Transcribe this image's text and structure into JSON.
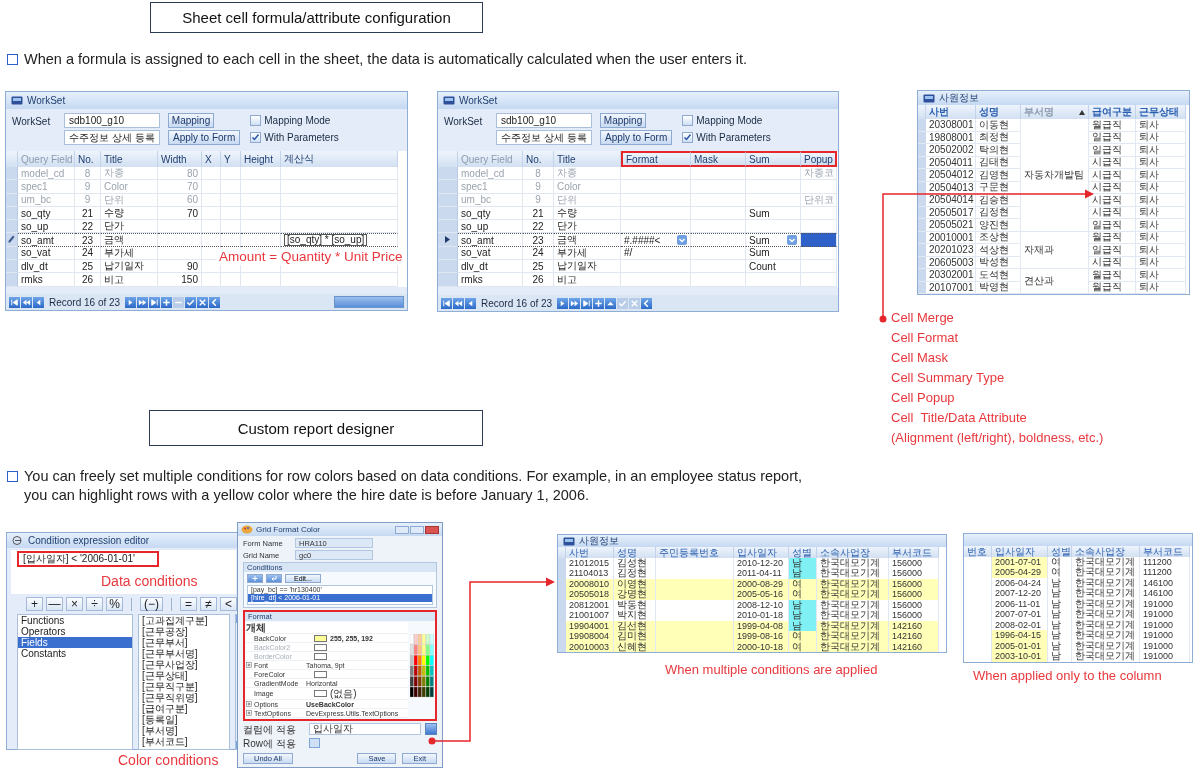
{
  "section1": {
    "heading": "Sheet cell formula/attribute configuration",
    "bullet": "When a formula is assigned to each cell in the sheet, the data is automatically calculated when the user enters it."
  },
  "workset_windows": [
    {
      "title": "WorkSet",
      "label": "WorkSet",
      "name_field": "sdb100_g10",
      "title_field": "수주정보 상세 등록",
      "buttons": [
        "Mapping",
        "Apply to Form"
      ],
      "checkboxes": [
        {
          "label": "Mapping Mode",
          "checked": false
        },
        {
          "label": "With Parameters",
          "checked": true
        }
      ],
      "kind": "edit",
      "scrollbar": true,
      "columns": [
        {
          "label": "Query Field",
          "highlighted": false
        },
        {
          "label": "No.",
          "highlighted": false
        },
        {
          "label": "Title",
          "highlighted": false
        },
        {
          "label": "Width",
          "highlighted": false
        },
        {
          "label": "X",
          "highlighted": false
        },
        {
          "label": "Y",
          "highlighted": false
        },
        {
          "label": "Height",
          "highlighted": false
        },
        {
          "label": "계산식",
          "highlighted": false
        }
      ],
      "rows": [
        {
          "cells": [
            "model_cd",
            "8",
            "차종",
            "80",
            null,
            null,
            null,
            null
          ],
          "disabled": true,
          "current": false
        },
        {
          "cells": [
            "spec1",
            "9",
            "Color",
            "70",
            null,
            null,
            null,
            null
          ],
          "disabled": true,
          "current": false
        },
        {
          "cells": [
            "um_bc",
            "9",
            "단위",
            "60",
            null,
            null,
            null,
            null
          ],
          "disabled": true,
          "current": false
        },
        {
          "cells": [
            "so_qty",
            "21",
            "수량",
            "70",
            null,
            null,
            null,
            null
          ],
          "disabled": false,
          "current": false
        },
        {
          "cells": [
            "so_up",
            "22",
            "단가",
            null,
            null,
            null,
            null,
            null
          ],
          "disabled": false,
          "current": false
        },
        {
          "cells": [
            "so_amt",
            "23",
            "금액",
            null,
            null,
            null,
            null,
            {
              "text": "[so_qty] * [so_up]",
              "editing": true
            }
          ],
          "disabled": false,
          "current": true
        },
        {
          "cells": [
            "so_vat",
            "24",
            "부가세",
            null,
            null,
            null,
            null,
            null
          ],
          "disabled": false,
          "current": false
        },
        {
          "cells": [
            "dlv_dt",
            "25",
            "납기일자",
            "90",
            null,
            null,
            null,
            null
          ],
          "disabled": false,
          "current": false
        },
        {
          "cells": [
            "rmks",
            "26",
            "비고",
            "150",
            null,
            null,
            null,
            null
          ],
          "disabled": false,
          "current": false
        }
      ],
      "annotation": "Amount = Quantity * Unit Price",
      "nav": [
        {
          "kind": "first",
          "disabled": false
        },
        {
          "kind": "prev-page",
          "disabled": false
        },
        {
          "kind": "prev",
          "disabled": false
        },
        {
          "kind": "record",
          "text": "Record 16 of 23"
        },
        {
          "kind": "next",
          "disabled": false
        },
        {
          "kind": "next-page",
          "disabled": false
        },
        {
          "kind": "last",
          "disabled": false
        },
        {
          "kind": "add",
          "disabled": false
        },
        {
          "kind": "remove",
          "disabled": true
        },
        {
          "kind": "ok",
          "disabled": false
        },
        {
          "kind": "cancel",
          "disabled": false
        },
        {
          "kind": "back",
          "disabled": false
        }
      ]
    },
    {
      "title": "WorkSet",
      "label": "WorkSet",
      "name_field": "sdb100_g10",
      "title_field": "수주정보 상세 등록",
      "buttons": [
        "Mapping",
        "Apply to Form"
      ],
      "checkboxes": [
        {
          "label": "Mapping Mode",
          "checked": false
        },
        {
          "label": "With Parameters",
          "checked": true
        }
      ],
      "kind": "browse",
      "columns": [
        {
          "label": "Query Field",
          "highlighted": false
        },
        {
          "label": "No.",
          "highlighted": false
        },
        {
          "label": "Title",
          "highlighted": false
        },
        {
          "label": "Format",
          "highlighted": true
        },
        {
          "label": "Mask",
          "highlighted": true
        },
        {
          "label": "Sum",
          "highlighted": true
        },
        {
          "label": "Popup",
          "highlighted": true
        }
      ],
      "rows": [
        {
          "cells": [
            "model_cd",
            "8",
            "차종",
            null,
            null,
            null,
            "차종코"
          ],
          "disabled": true,
          "current": false
        },
        {
          "cells": [
            "spec1",
            "9",
            "Color",
            null,
            null,
            null,
            null
          ],
          "disabled": true,
          "current": false
        },
        {
          "cells": [
            "um_bc",
            "9",
            "단위",
            null,
            null,
            null,
            "단위코"
          ],
          "disabled": true,
          "current": false
        },
        {
          "cells": [
            "so_qty",
            "21",
            "수량",
            null,
            null,
            "Sum",
            null
          ],
          "disabled": false,
          "current": false
        },
        {
          "cells": [
            "so_up",
            "22",
            "단가",
            null,
            null,
            null,
            null
          ],
          "disabled": false,
          "current": false
        },
        {
          "cells": [
            "so_amt",
            "23",
            "금액",
            {
              "text": "#.####<",
              "dropdown": true
            },
            null,
            {
              "text": "Sum",
              "dropdown": true
            },
            {
              "selected": true
            }
          ],
          "disabled": false,
          "current": true
        },
        {
          "cells": [
            "so_vat",
            "24",
            "부가세",
            "#/",
            null,
            "Sum",
            null
          ],
          "disabled": false,
          "current": false
        },
        {
          "cells": [
            "dlv_dt",
            "25",
            "납기일자",
            null,
            null,
            "Count",
            null
          ],
          "disabled": false,
          "current": false
        },
        {
          "cells": [
            "rmks",
            "26",
            "비고",
            null,
            null,
            null,
            null
          ],
          "disabled": false,
          "current": false
        }
      ],
      "nav": [
        {
          "kind": "first",
          "disabled": false
        },
        {
          "kind": "prev-page",
          "disabled": false
        },
        {
          "kind": "prev",
          "disabled": false
        },
        {
          "kind": "record",
          "text": "Record 16 of 23"
        },
        {
          "kind": "next",
          "disabled": false
        },
        {
          "kind": "next-page",
          "disabled": false
        },
        {
          "kind": "last",
          "disabled": false
        },
        {
          "kind": "add",
          "disabled": false
        },
        {
          "kind": "up",
          "disabled": false
        },
        {
          "kind": "ok",
          "disabled": true
        },
        {
          "kind": "cancel",
          "disabled": true
        },
        {
          "kind": "back",
          "disabled": false
        }
      ]
    }
  ],
  "employee_window": {
    "title": "사원정보",
    "columns": [
      {
        "label": "사번",
        "sorted": false
      },
      {
        "label": "성명",
        "sorted": false
      },
      {
        "label": "부서명",
        "sorted": true
      },
      {
        "label": "급여구분",
        "sorted": false
      },
      {
        "label": "근무상태",
        "sorted": false
      }
    ],
    "groups": [
      {
        "department": "자동차개발팀",
        "rows": [
          {
            "id": "20308001",
            "name": "이동현",
            "pay": "월급직",
            "status": "퇴사"
          },
          {
            "id": "19808001",
            "name": "최정현",
            "pay": "일급직",
            "status": "퇴사"
          },
          {
            "id": "20502002",
            "name": "탁의현",
            "pay": "일급직",
            "status": "퇴사"
          },
          {
            "id": "20504011",
            "name": "김태현",
            "pay": "시급직",
            "status": "퇴사"
          },
          {
            "id": "20504012",
            "name": "김영현",
            "pay": "시급직",
            "status": "퇴사"
          },
          {
            "id": "20504013",
            "name": "구문현",
            "pay": "시급직",
            "status": "퇴사"
          },
          {
            "id": "20504014",
            "name": "김승현",
            "pay": "시급직",
            "status": "퇴사"
          },
          {
            "id": "20505017",
            "name": "김정현",
            "pay": "시급직",
            "status": "퇴사"
          },
          {
            "id": "20505021",
            "name": "양진현",
            "pay": "일급직",
            "status": "퇴사"
          }
        ]
      },
      {
        "department": "자재과",
        "rows": [
          {
            "id": "20010001",
            "name": "조상현",
            "pay": "월급직",
            "status": "퇴사"
          },
          {
            "id": "20201023",
            "name": "석상현",
            "pay": "일급직",
            "status": "퇴사"
          },
          {
            "id": "20605003",
            "name": "박성현",
            "pay": "시급직",
            "status": "퇴사"
          }
        ]
      },
      {
        "department": "견산과",
        "rows": [
          {
            "id": "20302001",
            "name": "도석현",
            "pay": "월급직",
            "status": "퇴사"
          },
          {
            "id": "20107001",
            "name": "박영현",
            "pay": "월급직",
            "status": "퇴사"
          }
        ]
      }
    ]
  },
  "callouts": [
    "Cell Merge",
    "Cell Format",
    "Cell Mask",
    "Cell Summary Type",
    "Cell Popup",
    "Cell  Title/Data Attribute",
    "(Alignment (left/right), boldness, etc.)"
  ],
  "section2": {
    "heading": "Custom report designer",
    "bullet": "You can freely set multiple conditions for row colors based on data conditions. For example, in an employee status report, you can highlight rows with a yellow color where the hire date is before January 1, 2006."
  },
  "condition_editor": {
    "title": "Condition expression editor",
    "expression": "[입사일자] < '2006-01-01'",
    "annotation": "Data conditions",
    "operator_groups": [
      [
        "+",
        "—",
        "×",
        "÷",
        "%"
      ],
      [
        "(−)"
      ],
      [
        "=",
        "≠",
        "<"
      ]
    ],
    "categories": [
      {
        "label": "Functions",
        "selected": false
      },
      {
        "label": "Operators",
        "selected": false
      },
      {
        "label": "Fields",
        "selected": true
      },
      {
        "label": "Constants",
        "selected": false
      }
    ],
    "fields": [
      "[고과집계구분]",
      "[근무공장]",
      "[근무부서]",
      "[근무부서명]",
      "[근무사업장]",
      "[근무상태]",
      "[근무직구분]",
      "[근무직위명]",
      "[급여구분]",
      "[등록일]",
      "[부서명]",
      "[부서코드]"
    ]
  },
  "color_annotation": "Color conditions",
  "format_dialog": {
    "title": "Grid Format Color",
    "form_name_label": "Form Name",
    "form_name": "HRA110",
    "grid_name_label": "Grid Name",
    "grid_name": "gc0",
    "conditions_label": "Conditions",
    "edit_button": "Edit...",
    "conditions": [
      {
        "text": "[pay_bc] == 'hr130400'",
        "selected": false
      },
      {
        "text": "[hire_dt] < 2006-01-01",
        "selected": true
      }
    ],
    "format_label": "Format",
    "properties": [
      {
        "name": "개체",
        "kind": "category"
      },
      {
        "name": "BackColor",
        "kind": "color",
        "color": "#ffff99",
        "value": "255, 255, 192",
        "bold": true,
        "disabled": false
      },
      {
        "name": "BackColor2",
        "kind": "color",
        "color": "#ffffff",
        "disabled": true
      },
      {
        "name": "BorderColor",
        "kind": "color",
        "color": "#ffffff",
        "disabled": true
      },
      {
        "name": "Font",
        "kind": "group",
        "value": "Tahoma, 9pt",
        "bold": false
      },
      {
        "name": "ForeColor",
        "kind": "color",
        "color": "#ffffff",
        "disabled": false
      },
      {
        "name": "GradientMode",
        "kind": "text",
        "value": "Horizontal",
        "bold": false
      },
      {
        "name": "Image",
        "kind": "color",
        "color": "#ffffff",
        "value": "(없음)",
        "bold": false,
        "disabled": false
      },
      {
        "name": "Options",
        "kind": "group",
        "value": "UseBackColor",
        "bold": true
      },
      {
        "name": "TextOptions",
        "kind": "group",
        "value": "DevExpress.Utils.TextOptions",
        "bold": false
      }
    ],
    "apply_column": {
      "label": "컬럼에 적용",
      "value": "입사일자"
    },
    "apply_row": {
      "label": "Row에 적용",
      "checked": false
    },
    "buttons": [
      "Undo All",
      "Save",
      "Exit"
    ]
  },
  "report_grids": [
    {
      "title": "사원정보",
      "columns": [
        "사번",
        "성명",
        "주민등록번호",
        "입사일자",
        "성별",
        "소속사업장",
        "부서코드"
      ],
      "rows": [
        {
          "cells": [
            "21012015",
            "김성현",
            null,
            "2010-12-20",
            {
              "text": "남",
              "highlighted": true
            },
            "한국대모기계",
            "156000"
          ],
          "highlighted": false
        },
        {
          "cells": [
            "21104013",
            "김정현",
            null,
            "2011-04-11",
            {
              "text": "남",
              "highlighted": true
            },
            "한국대모기계",
            "156000"
          ],
          "highlighted": false
        },
        {
          "cells": [
            "20008010",
            "이영현",
            null,
            "2000-08-29",
            {
              "text": "여",
              "highlighted": false
            },
            "한국대모기계",
            "156000"
          ],
          "highlighted": true
        },
        {
          "cells": [
            "20505018",
            "강명현",
            null,
            "2005-05-16",
            {
              "text": "여",
              "highlighted": false
            },
            "한국대모기계",
            "156000"
          ],
          "highlighted": true
        },
        {
          "cells": [
            "20812001",
            "박동현",
            null,
            "2008-12-10",
            {
              "text": "남",
              "highlighted": true
            },
            "한국대모기계",
            "156000"
          ],
          "highlighted": false
        },
        {
          "cells": [
            "21001007",
            "박지현",
            null,
            "2010-01-18",
            {
              "text": "남",
              "highlighted": true
            },
            "한국대모기계",
            "156000"
          ],
          "highlighted": false
        },
        {
          "cells": [
            "19904001",
            "김선현",
            null,
            "1999-04-08",
            {
              "text": "남",
              "highlighted": true
            },
            "한국대모기계",
            "142160"
          ],
          "highlighted": true
        },
        {
          "cells": [
            "19908004",
            "김미현",
            null,
            "1999-08-16",
            {
              "text": "여",
              "highlighted": false
            },
            "한국대모기계",
            "142160"
          ],
          "highlighted": true
        },
        {
          "cells": [
            "20010003",
            "신혜현",
            null,
            "2000-10-18",
            {
              "text": "여",
              "highlighted": false
            },
            "한국대모기계",
            "142160"
          ],
          "highlighted": true
        }
      ],
      "caption": "When multiple conditions are applied"
    },
    {
      "columns": [
        "번호",
        "입사일자",
        "성별",
        "소속사업장",
        "부서코드"
      ],
      "rows": [
        {
          "cells": [
            null,
            {
              "text": "2001-07-01",
              "highlighted": true
            },
            "여",
            "한국대모기계",
            "111200"
          ],
          "highlighted": false
        },
        {
          "cells": [
            null,
            {
              "text": "2005-04-29",
              "highlighted": true
            },
            "여",
            "한국대모기계",
            "111200"
          ],
          "highlighted": false
        },
        {
          "cells": [
            null,
            {
              "text": "2006-04-24",
              "highlighted": false
            },
            "남",
            "한국대모기계",
            "146100"
          ],
          "highlighted": false
        },
        {
          "cells": [
            null,
            {
              "text": "2007-12-20",
              "highlighted": false
            },
            "남",
            "한국대모기계",
            "146100"
          ],
          "highlighted": false
        },
        {
          "cells": [
            null,
            {
              "text": "2006-11-01",
              "highlighted": false
            },
            "남",
            "한국대모기계",
            "191000"
          ],
          "highlighted": false
        },
        {
          "cells": [
            null,
            {
              "text": "2007-07-01",
              "highlighted": false
            },
            "남",
            "한국대모기계",
            "191000"
          ],
          "highlighted": false
        },
        {
          "cells": [
            null,
            {
              "text": "2008-02-01",
              "highlighted": false
            },
            "남",
            "한국대모기계",
            "191000"
          ],
          "highlighted": false
        },
        {
          "cells": [
            null,
            {
              "text": "1996-04-15",
              "highlighted": true
            },
            "남",
            "한국대모기계",
            "191000"
          ],
          "highlighted": false
        },
        {
          "cells": [
            null,
            {
              "text": "2005-01-01",
              "highlighted": true
            },
            "남",
            "한국대모기계",
            "191000"
          ],
          "highlighted": false
        },
        {
          "cells": [
            null,
            {
              "text": "2003-10-01",
              "highlighted": true
            },
            "남",
            "한국대모기계",
            "191000"
          ],
          "highlighted": false
        }
      ],
      "caption": "When applied only to the column"
    }
  ]
}
